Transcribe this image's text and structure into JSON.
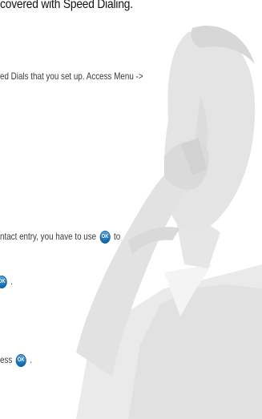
{
  "heading": "covered with Speed Dialing.",
  "lines": {
    "speed_dials": "ed Dials that you set up. Access Menu ->",
    "contact_entry_before": "ntact entry, you have to use",
    "contact_entry_after": "to",
    "line3_after": ".",
    "line4_before": "ess",
    "line4_after": "."
  },
  "ok_key": {
    "label": "OK",
    "color": "#1e7fc9"
  },
  "icons": [
    "ok-key-icon"
  ]
}
